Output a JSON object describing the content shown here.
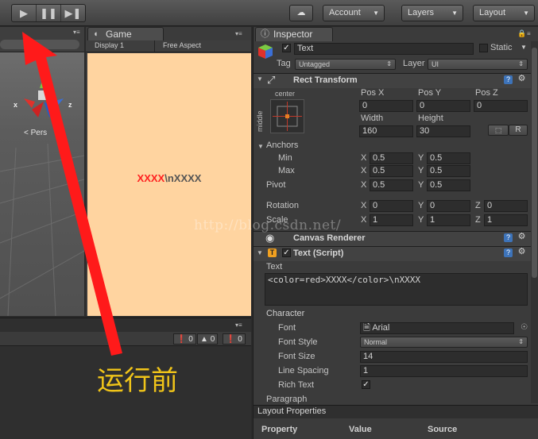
{
  "toolbar": {
    "account_label": "Account",
    "layers_label": "Layers",
    "layout_label": "Layout"
  },
  "scene": {
    "axis_x": "x",
    "axis_z": "z",
    "persp_label": "< Pers"
  },
  "game": {
    "tab_label": "Game",
    "display_label": "Display 1",
    "aspect_label": "Free Aspect",
    "text_red": "XXXX",
    "text_rest": "\\nXXXX"
  },
  "console": {
    "errors_count": "0",
    "warnings_count": "0",
    "messages_count": "0"
  },
  "inspector": {
    "tab_label": "Inspector",
    "object_name": "Text",
    "static_label": "Static",
    "tag_label": "Tag",
    "tag_value": "Untagged",
    "layer_label": "Layer",
    "layer_value": "UI",
    "rect_transform": {
      "title": "Rect Transform",
      "anchor_h": "center",
      "anchor_v": "middle",
      "pos_x_label": "Pos X",
      "pos_y_label": "Pos Y",
      "pos_z_label": "Pos Z",
      "pos_x": "0",
      "pos_y": "0",
      "pos_z": "0",
      "width_label": "Width",
      "height_label": "Height",
      "width": "160",
      "height": "30",
      "r_label": "R",
      "anchors_label": "Anchors",
      "min_label": "Min",
      "max_label": "Max",
      "pivot_label": "Pivot",
      "min_x": "0.5",
      "min_y": "0.5",
      "max_x": "0.5",
      "max_y": "0.5",
      "pivot_x": "0.5",
      "pivot_y": "0.5",
      "rotation_label": "Rotation",
      "scale_label": "Scale",
      "rot_x": "0",
      "rot_y": "0",
      "rot_z": "0",
      "scale_x": "1",
      "scale_y": "1",
      "scale_z": "1",
      "x_label": "X",
      "y_label": "Y",
      "z_label": "Z"
    },
    "canvas_renderer": {
      "title": "Canvas Renderer"
    },
    "text_script": {
      "title": "Text (Script)",
      "text_label": "Text",
      "text_value": "<color=red>XXXX</color>\\nXXXX",
      "character_label": "Character",
      "font_label": "Font",
      "font_value": "Arial",
      "font_style_label": "Font Style",
      "font_style_value": "Normal",
      "font_size_label": "Font Size",
      "font_size_value": "14",
      "line_spacing_label": "Line Spacing",
      "line_spacing_value": "1",
      "rich_text_label": "Rich Text",
      "paragraph_label": "Paragraph"
    },
    "layout_properties": {
      "title": "Layout Properties",
      "col_property": "Property",
      "col_value": "Value",
      "col_source": "Source"
    }
  },
  "overlay": {
    "caption": "运行前",
    "watermark": "http://blog.csdn.net/"
  },
  "colors": {
    "arrow": "#ff1a1a",
    "caption": "#f0c419",
    "game_bg": "#ffd4a0",
    "rich_red": "#ff2020"
  }
}
